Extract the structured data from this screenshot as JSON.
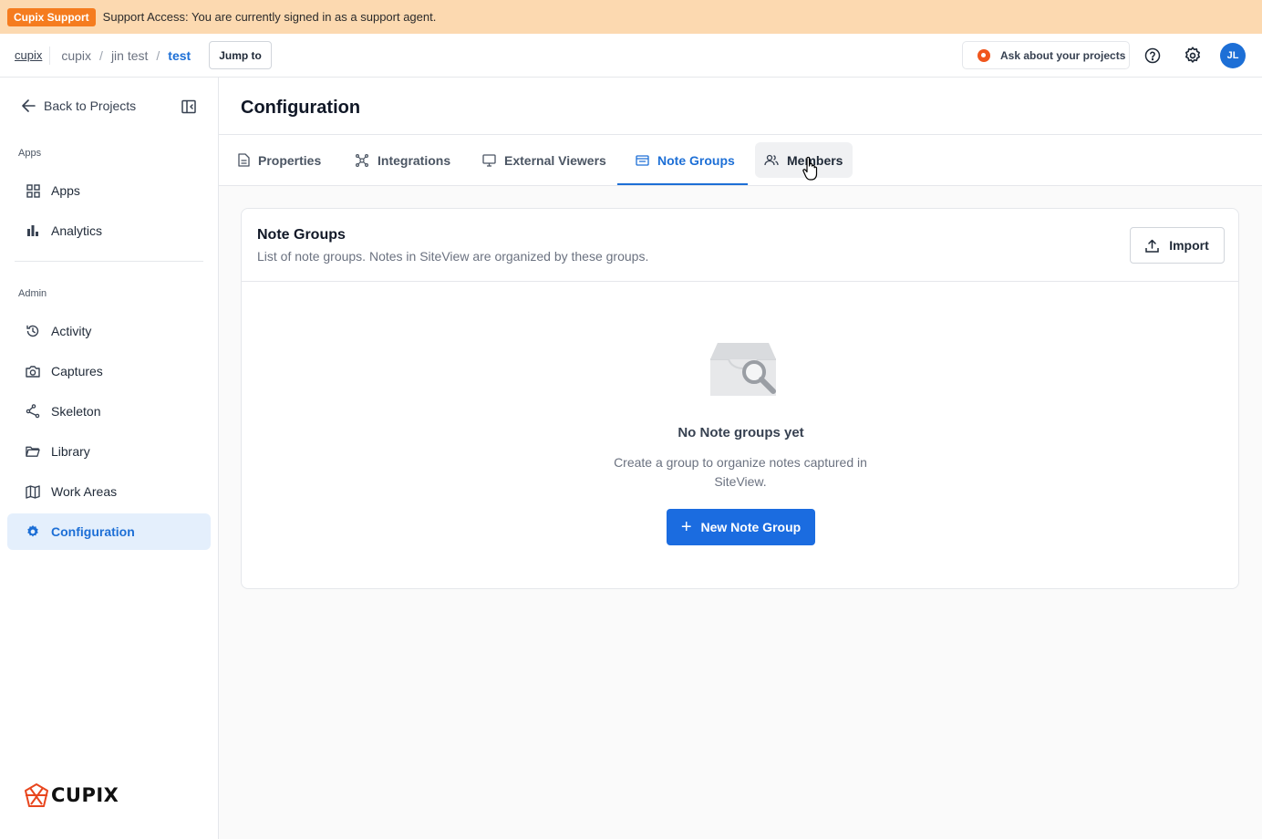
{
  "banner": {
    "badge": "Cupix Support",
    "message": "Support Access: You are currently signed in as a support agent.",
    "bg_color": "#fcd9b0",
    "badge_color": "#f57c1f"
  },
  "topnav": {
    "org": "cupix",
    "breadcrumbs": [
      "cupix",
      "jin test",
      "test"
    ],
    "breadcrumb_sep": "/",
    "jump_label": "Jump to",
    "ask_label": "Ask about your projects",
    "avatar_initials": "JL",
    "help_icon": "help-circle-icon",
    "settings_icon": "gear-icon"
  },
  "sidebar": {
    "back_label": "Back to Projects",
    "apps_section": "Apps",
    "apps_items": [
      {
        "label": "Apps",
        "icon": "apps-grid-icon"
      },
      {
        "label": "Analytics",
        "icon": "bar-chart-icon"
      }
    ],
    "admin_section": "Admin",
    "admin_items": [
      {
        "label": "Activity",
        "icon": "history-icon"
      },
      {
        "label": "Captures",
        "icon": "camera-icon"
      },
      {
        "label": "Skeleton",
        "icon": "skeleton-icon"
      },
      {
        "label": "Library",
        "icon": "folder-icon"
      },
      {
        "label": "Work Areas",
        "icon": "map-icon"
      },
      {
        "label": "Configuration",
        "icon": "gear-icon",
        "active": true
      }
    ],
    "logo_text": "CUPIX"
  },
  "main": {
    "title": "Configuration",
    "tabs": [
      {
        "label": "Properties",
        "icon": "document-icon"
      },
      {
        "label": "Integrations",
        "icon": "integration-icon"
      },
      {
        "label": "External Viewers",
        "icon": "monitor-icon"
      },
      {
        "label": "Note Groups",
        "icon": "note-icon",
        "active": true
      },
      {
        "label": "Members",
        "icon": "members-icon",
        "hover": true
      }
    ],
    "card": {
      "title": "Note Groups",
      "description": "List of note groups. Notes in SiteView are organized by these groups.",
      "import_label": "Import",
      "empty_title": "No Note groups yet",
      "empty_desc": "Create a group to organize notes captured in SiteView.",
      "new_button": "New Note Group"
    }
  },
  "colors": {
    "accent": "#1d6fd6",
    "primary_button": "#1b6ce0"
  }
}
